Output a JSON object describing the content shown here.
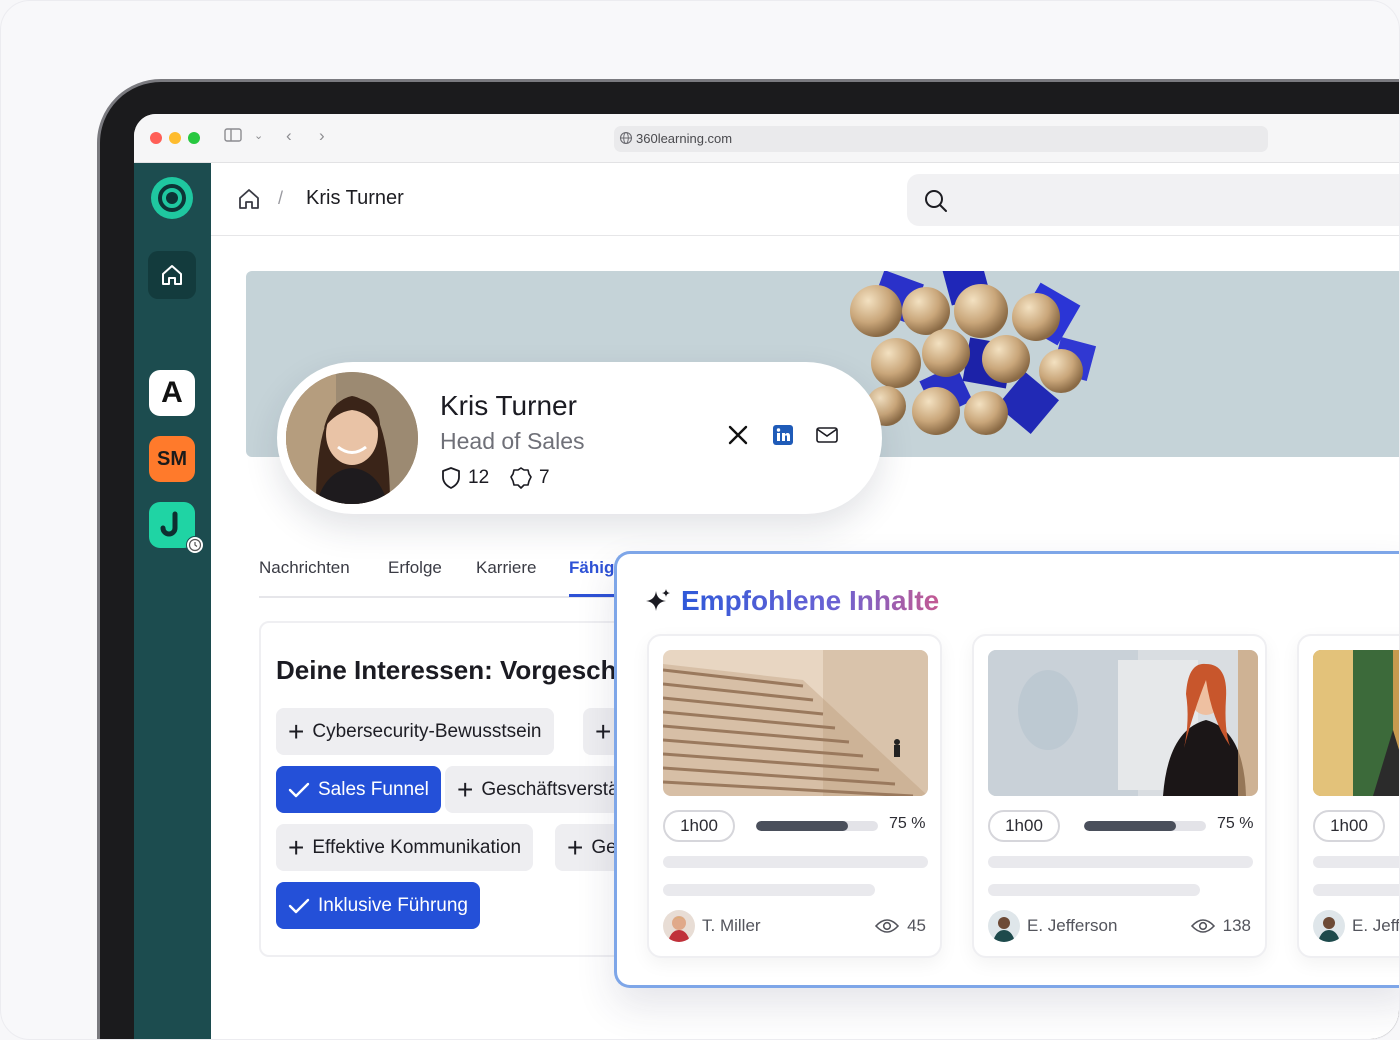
{
  "browser": {
    "url": "360learning.com"
  },
  "sidebar": {
    "apps": [
      {
        "label": "A"
      },
      {
        "label": "SM"
      },
      {
        "label": "J"
      }
    ]
  },
  "breadcrumb": {
    "current": "Kris Turner",
    "separator": "/"
  },
  "profile": {
    "name": "Kris Turner",
    "role": "Head of Sales",
    "badges_count": "12",
    "certificates_count": "7"
  },
  "tabs": [
    {
      "label": "Nachrichten"
    },
    {
      "label": "Erfolge"
    },
    {
      "label": "Karriere"
    },
    {
      "label": "Fähigkeiten"
    }
  ],
  "interests": {
    "title": "Deine Interessen: Vorgeschlagen",
    "chips": [
      {
        "label": "Cybersecurity-Bewusstsein",
        "selected": false
      },
      {
        "label": "Sales Funnel",
        "selected": true
      },
      {
        "label": "Geschäftsverständnis",
        "selected": false
      },
      {
        "label": "Effektive Kommunikation",
        "selected": false
      },
      {
        "label": "Ge",
        "selected": false
      },
      {
        "label": "Inklusive Führung",
        "selected": true
      }
    ]
  },
  "recommended": {
    "title": "Empfohlene Inhalte",
    "cards": [
      {
        "duration": "1h00",
        "progress_percent": 75,
        "progress_label": "75 %",
        "author": "T. Miller",
        "views": "45"
      },
      {
        "duration": "1h00",
        "progress_percent": 75,
        "progress_label": "75 %",
        "author": "E. Jefferson",
        "views": "138"
      },
      {
        "duration": "1h00",
        "progress_percent": null,
        "progress_label": "",
        "author": "E. Jefferson",
        "views": ""
      }
    ]
  },
  "colors": {
    "sidebar": "#1c4c4f",
    "accent_blue": "#2450d8",
    "brand_green": "#1fc7a0",
    "sm_orange": "#ff7a2b"
  }
}
